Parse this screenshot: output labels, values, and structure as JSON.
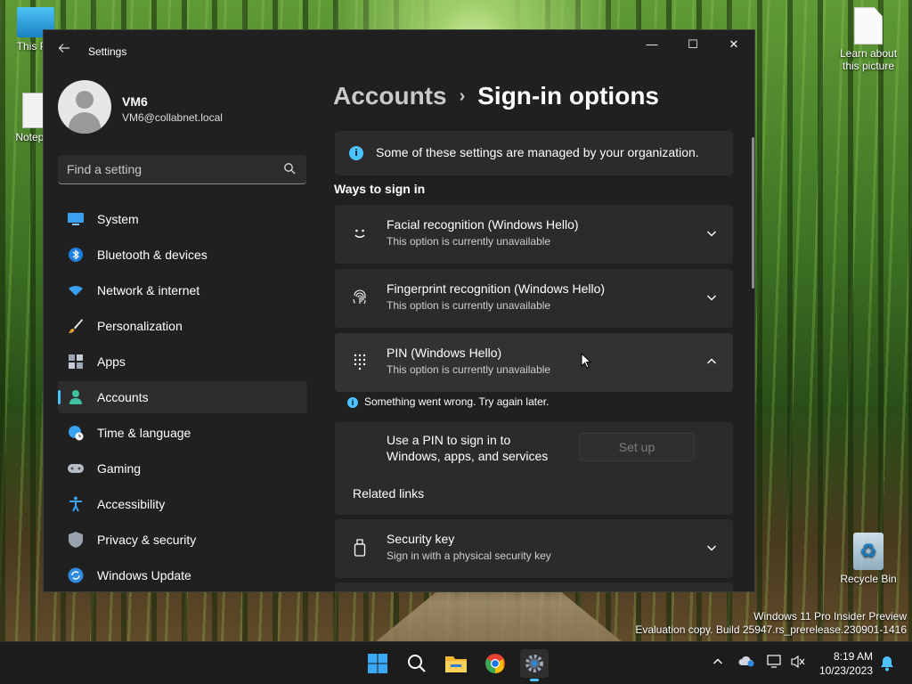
{
  "desktop": {
    "icons": [
      {
        "label": "This PC"
      },
      {
        "label": "Notepad"
      },
      {
        "label": "Learn about this picture"
      },
      {
        "label": "Recycle Bin"
      }
    ],
    "watermark_line1": "Windows 11 Pro Insider Preview",
    "watermark_line2": "Evaluation copy. Build 25947.rs_prerelease.230901-1416"
  },
  "window": {
    "title": "Settings",
    "controls": {
      "minimize": "—",
      "maximize": "☐",
      "close": "✕"
    }
  },
  "profile": {
    "name": "VM6",
    "email": "VM6@collabnet.local"
  },
  "search": {
    "placeholder": "Find a setting"
  },
  "nav": {
    "items": [
      {
        "label": "System",
        "icon": "system-icon"
      },
      {
        "label": "Bluetooth & devices",
        "icon": "bluetooth-icon"
      },
      {
        "label": "Network & internet",
        "icon": "wifi-icon"
      },
      {
        "label": "Personalization",
        "icon": "brush-icon"
      },
      {
        "label": "Apps",
        "icon": "apps-icon"
      },
      {
        "label": "Accounts",
        "icon": "person-icon",
        "active": true
      },
      {
        "label": "Time & language",
        "icon": "clock-globe-icon"
      },
      {
        "label": "Gaming",
        "icon": "gamepad-icon"
      },
      {
        "label": "Accessibility",
        "icon": "accessibility-icon"
      },
      {
        "label": "Privacy & security",
        "icon": "shield-icon"
      },
      {
        "label": "Windows Update",
        "icon": "update-icon"
      }
    ]
  },
  "breadcrumb": {
    "parent": "Accounts",
    "separator": "›",
    "current": "Sign-in options"
  },
  "info_banner": {
    "text": "Some of these settings are managed by your organization."
  },
  "ways_to_sign_in": {
    "title": "Ways to sign in",
    "options": [
      {
        "title": "Facial recognition (Windows Hello)",
        "subtitle": "This option is currently unavailable",
        "icon": "face-icon",
        "expanded": false
      },
      {
        "title": "Fingerprint recognition (Windows Hello)",
        "subtitle": "This option is currently unavailable",
        "icon": "fingerprint-icon",
        "expanded": false
      },
      {
        "title": "PIN (Windows Hello)",
        "subtitle": "This option is currently unavailable",
        "icon": "pin-keypad-icon",
        "expanded": true
      }
    ]
  },
  "pin_panel": {
    "error": "Something went wrong. Try again later.",
    "description": "Use a PIN to sign in to Windows, apps, and services",
    "setup_button": "Set up",
    "setup_enabled": false,
    "related_links": "Related links"
  },
  "security_key": {
    "title": "Security key",
    "subtitle": "Sign in with a physical security key",
    "icon": "usb-key-icon"
  },
  "taskbar": {
    "apps": [
      {
        "name": "start-button"
      },
      {
        "name": "search-taskbar"
      },
      {
        "name": "file-explorer"
      },
      {
        "name": "chrome"
      },
      {
        "name": "settings",
        "active": true
      }
    ],
    "time": "8:19 AM",
    "date": "10/23/2023"
  },
  "colors": {
    "accent": "#4cc2ff",
    "window_bg": "#202020",
    "card_bg": "#2b2b2b"
  }
}
